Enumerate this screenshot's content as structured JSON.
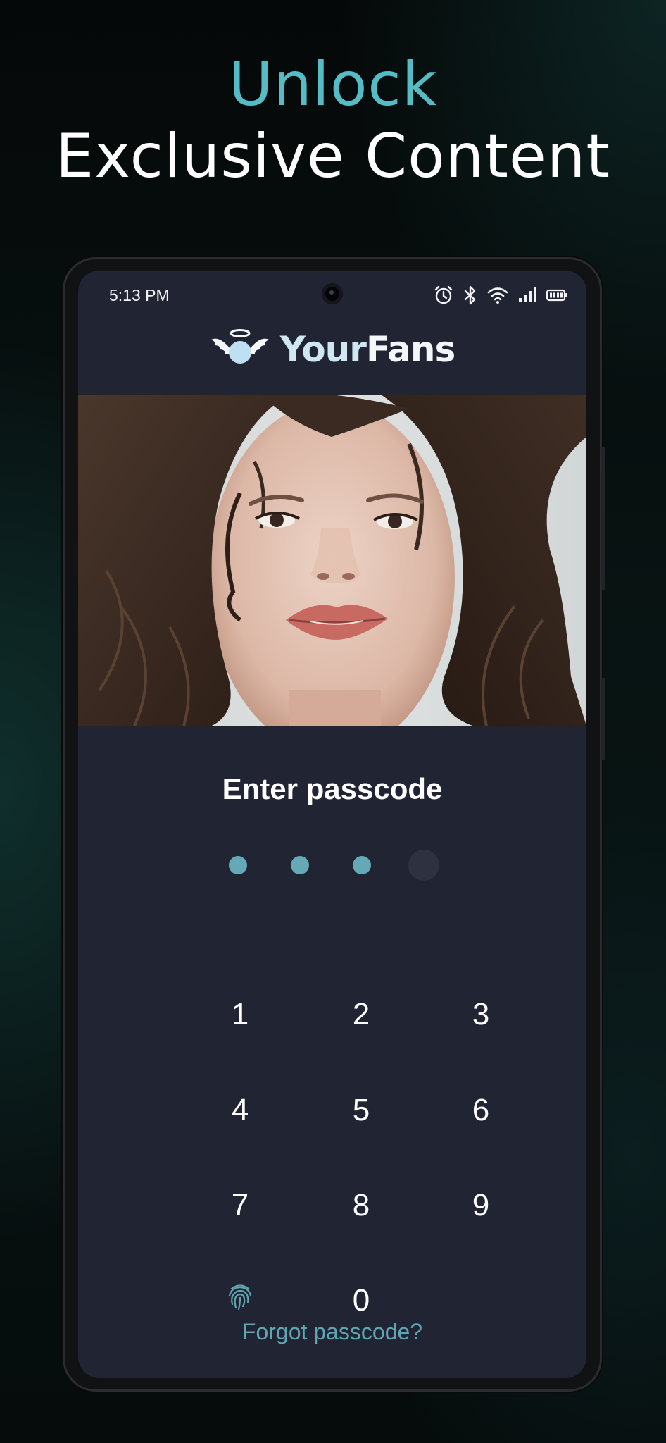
{
  "hero": {
    "line1": "Unlock",
    "line2": "Exclusive Content",
    "accent_color": "#55bcc6"
  },
  "status_bar": {
    "time": "5:13 PM",
    "icons": [
      "alarm-icon",
      "bluetooth-icon",
      "wifi-icon",
      "signal-icon",
      "battery-icon"
    ]
  },
  "app": {
    "logo_part1": "Your",
    "logo_part2": "Fans",
    "logo_icon": "winged-angel-halo-icon"
  },
  "profile_photo": {
    "subject": "portrait-photo"
  },
  "passcode": {
    "title": "Enter passcode",
    "digits_entered": 3,
    "digits_total": 4,
    "filled_color": "#66a9b6",
    "empty_color": "#2e3140",
    "keys": [
      "1",
      "2",
      "3",
      "4",
      "5",
      "6",
      "7",
      "8",
      "9",
      "0"
    ],
    "biometric_icon": "fingerprint-icon",
    "forgot_label": "Forgot passcode?"
  }
}
